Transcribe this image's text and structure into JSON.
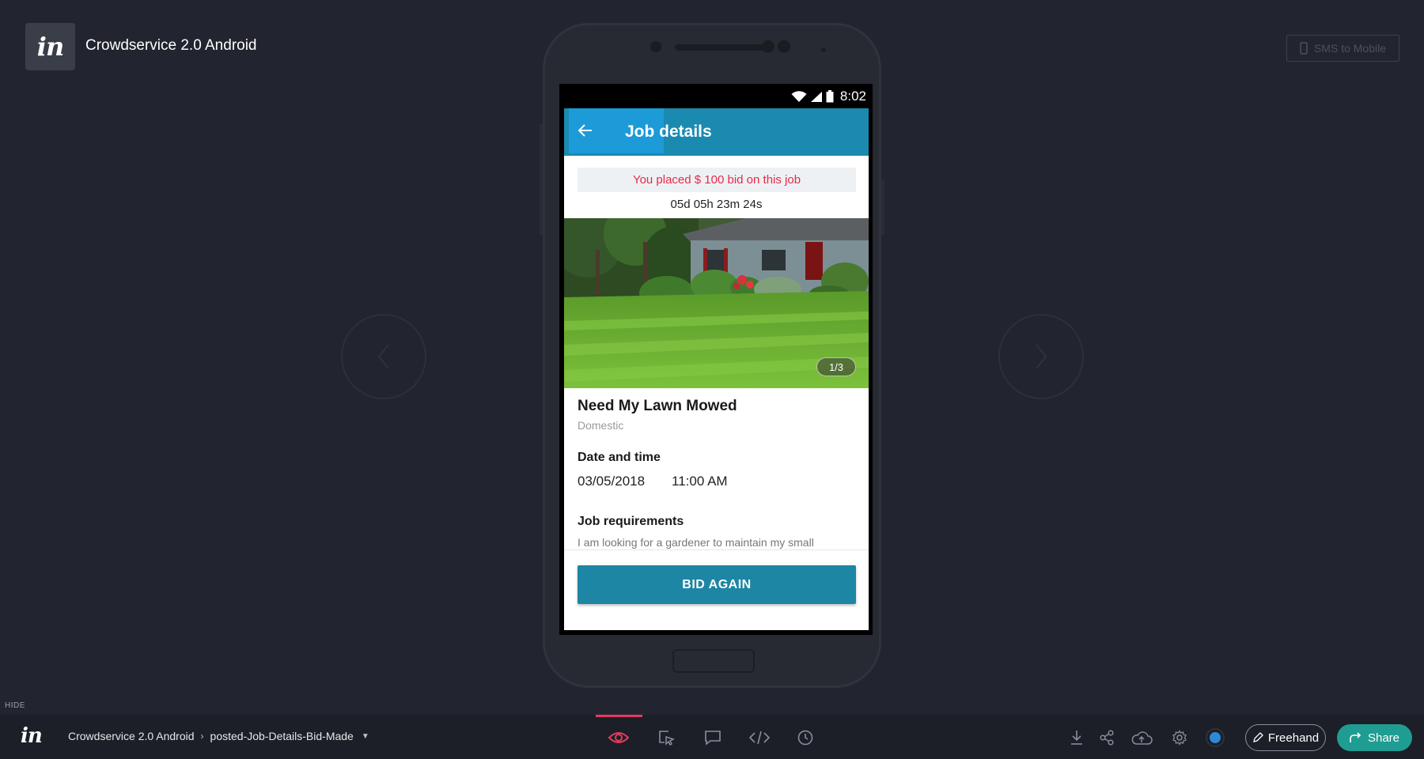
{
  "header": {
    "logo_text": "in",
    "project_title": "Crowdservice 2.0 Android",
    "sms_button_label": "SMS to Mobile"
  },
  "phone": {
    "status_time": "8:02",
    "app_bar_title": "Job details",
    "bid_banner": "You placed $ 100 bid on this job",
    "countdown": "05d 05h 23m 24s",
    "photo_counter": "1/3",
    "job_title": "Need My Lawn Mowed",
    "job_category": "Domestic",
    "date_time_label": "Date and time",
    "date_value": "03/05/2018",
    "time_value": "11:00 AM",
    "requirements_label": "Job requirements",
    "requirements_text": "I am looking for a gardener to maintain my small",
    "bid_again_label": "BID AGAIN"
  },
  "toolbar": {
    "hide_label": "HIDE",
    "logo_text": "in",
    "breadcrumb_project": "Crowdservice 2.0 Android",
    "breadcrumb_screen": "posted-Job-Details-Bid-Made",
    "freehand_label": "Freehand",
    "share_label": "Share"
  },
  "colors": {
    "background": "#22252f",
    "app_bar": "#1b8ab0",
    "bid_button": "#1d86a4",
    "bid_banner_text": "#e8294a",
    "active_mode": "#e33b5d",
    "share_button": "#1f9d92"
  }
}
